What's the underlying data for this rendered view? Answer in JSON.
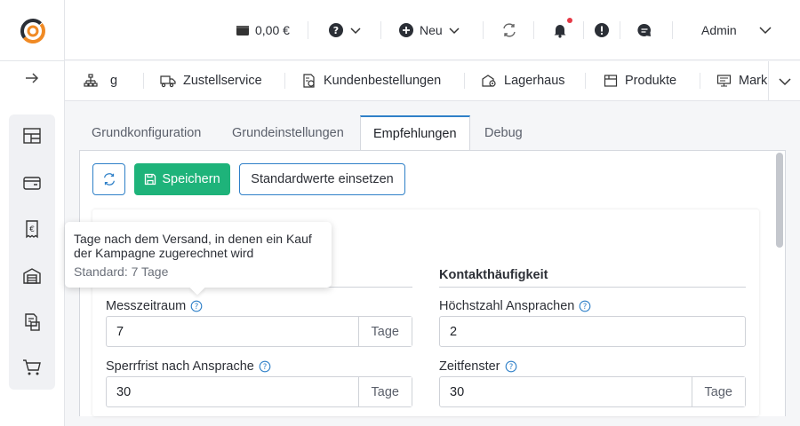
{
  "colors": {
    "accent": "#2f80c8",
    "save_bg": "#1eb37a",
    "notification_dot": "#e63946",
    "logo_orange": "#f08a24",
    "logo_dark": "#2b2f36"
  },
  "header": {
    "balance": "0,00 €",
    "new_label": "Neu",
    "user_label": "Admin"
  },
  "modules": [
    {
      "label": "g",
      "icon": "sitemap-icon"
    },
    {
      "label": "Zustellservice",
      "icon": "delivery-truck-icon"
    },
    {
      "label": "Kundenbestellungen",
      "icon": "order-document-icon"
    },
    {
      "label": "Lagerhaus",
      "icon": "warehouse-gear-icon"
    },
    {
      "label": "Produkte",
      "icon": "product-box-icon"
    },
    {
      "label": "Mark",
      "icon": "monitor-icon"
    }
  ],
  "tabs": [
    {
      "label": "Grundkonfiguration",
      "active": false
    },
    {
      "label": "Grundeinstellungen",
      "active": false
    },
    {
      "label": "Empfehlungen",
      "active": true
    },
    {
      "label": "Debug",
      "active": false
    }
  ],
  "toolbar": {
    "save_label": "Speichern",
    "defaults_label": "Standardwerte einsetzen"
  },
  "tooltip": {
    "text": "Tage nach dem Versand, in denen ein Kauf der Kampagne zugerechnet wird",
    "default_text": "Standard: 7 Tage"
  },
  "right_section": {
    "title": "Kontakthäufigkeit"
  },
  "fields": {
    "messzeitraum": {
      "label": "Messzeitraum",
      "value": "7",
      "unit": "Tage"
    },
    "sperrfrist": {
      "label": "Sperrfrist nach Ansprache",
      "value": "30",
      "unit": "Tage"
    },
    "hoechstzahl": {
      "label": "Höchstzahl Ansprachen",
      "value": "2"
    },
    "zeitfenster": {
      "label": "Zeitfenster",
      "value": "30",
      "unit": "Tage"
    }
  }
}
